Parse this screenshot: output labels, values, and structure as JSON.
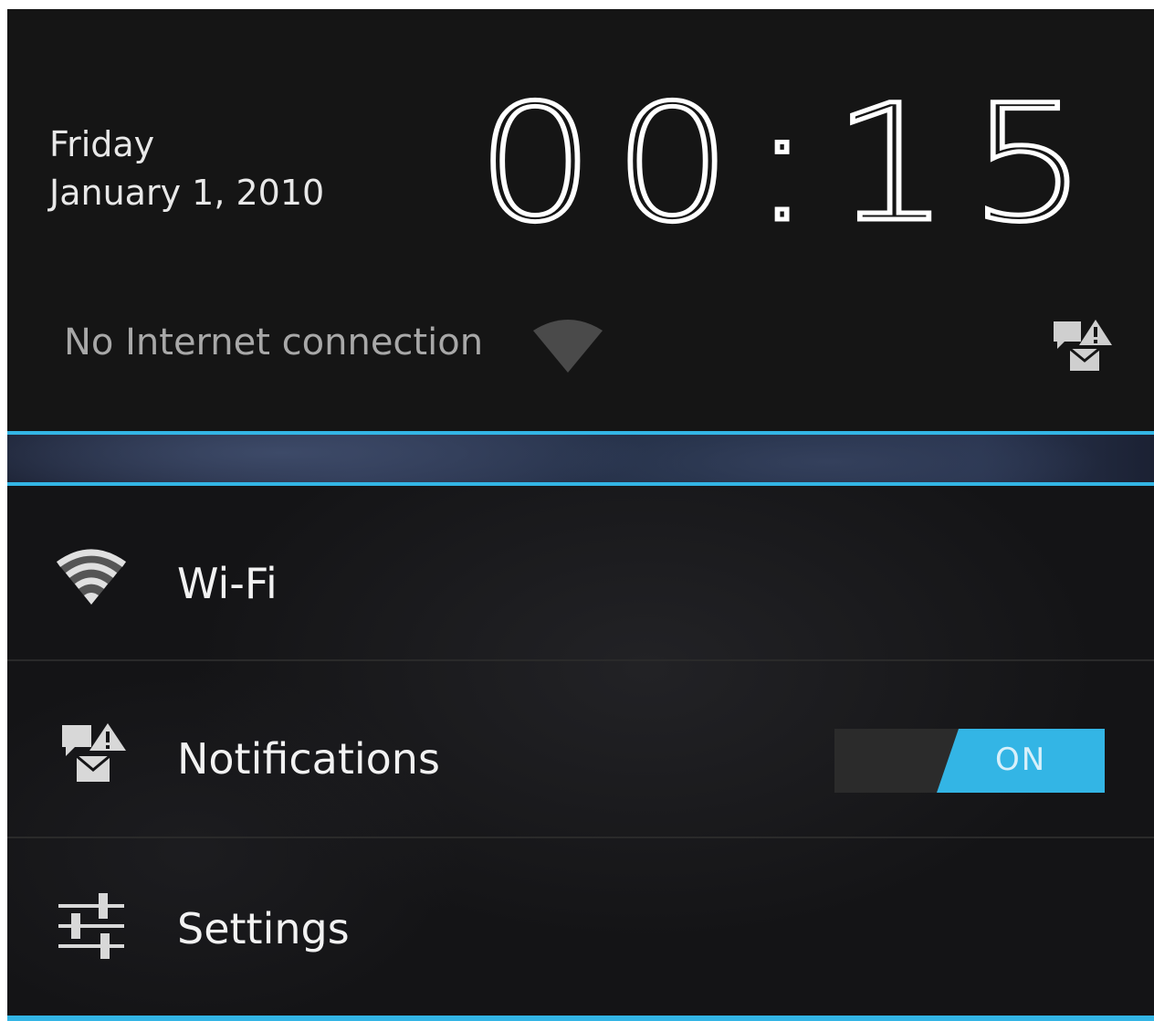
{
  "header": {
    "day": "Friday",
    "date": "January 1, 2010",
    "time": "00:15",
    "connection_status": "No Internet connection"
  },
  "icons": {
    "signal": "wifi-off-icon",
    "notifications_status": "notifications-icon",
    "wifi": "wifi-icon",
    "notifications": "notifications-icon",
    "settings": "settings-sliders-icon"
  },
  "quick_settings": [
    {
      "label": "Wi-Fi"
    },
    {
      "label": "Notifications",
      "toggle": "ON"
    },
    {
      "label": "Settings"
    }
  ],
  "colors": {
    "accent": "#33b5e5",
    "background": "#151515",
    "text_primary": "#f2f2f2",
    "text_secondary": "#a8a8a8"
  }
}
